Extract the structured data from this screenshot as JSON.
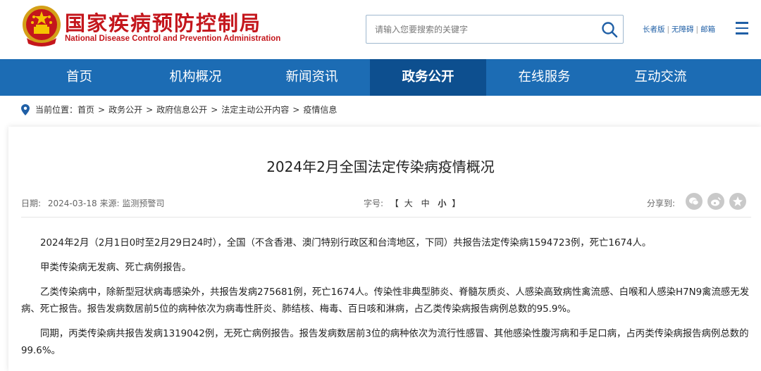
{
  "header": {
    "logo_cn": "国家疾病预防控制局",
    "logo_en": "National Disease Control and Prevention Administration",
    "search_placeholder": "请输入您要搜索的关键字",
    "links": [
      "长者版",
      "无障碍",
      "邮箱"
    ]
  },
  "nav": {
    "items": [
      "首页",
      "机构概况",
      "新闻资讯",
      "政务公开",
      "在线服务",
      "互动交流"
    ],
    "active_index": 3
  },
  "breadcrumb": {
    "label": "当前位置：",
    "items": [
      "首页",
      "政务公开",
      "政府信息公开",
      "法定主动公开内容",
      "疫情信息"
    ],
    "separator": ">"
  },
  "article": {
    "title": "2024年2月全国法定传染病疫情概况",
    "meta": {
      "date_label": "日期:",
      "date": "2024-03-18",
      "source_label": "来源:",
      "source": "监测预警司",
      "font_label": "字号:",
      "bracket_open": "【",
      "bracket_close": "】",
      "font_sizes": [
        "大",
        "中",
        "小"
      ],
      "share_label": "分享到:"
    },
    "paragraphs": [
      "2024年2月（2月1日0时至2月29日24时），全国（不含香港、澳门特别行政区和台湾地区，下同）共报告法定传染病1594723例，死亡1674人。",
      "甲类传染病无发病、死亡病例报告。",
      "乙类传染病中，除新型冠状病毒感染外，共报告发病275681例，死亡1674人。传染性非典型肺炎、脊髓灰质炎、人感染高致病性禽流感、白喉和人感染H7N9禽流感无发病、死亡报告。报告发病数居前5位的病种依次为病毒性肝炎、肺结核、梅毒、百日咳和淋病，占乙类传染病报告病例总数的95.9%。",
      "同期，丙类传染病共报告发病1319042例，无死亡病例报告。报告发病数居前3位的病种依次为流行性感冒、其他感染性腹泻病和手足口病，占丙类传染病报告病例总数的99.6%。"
    ]
  },
  "colors": {
    "brand_red": "#c4161c",
    "nav_blue": "#1c6cb4",
    "nav_active": "#0d4f8f",
    "link_blue": "#1f5fa6"
  },
  "icons": {
    "emblem": "national-emblem-icon",
    "search": "search-icon",
    "menu": "hamburger-menu-icon",
    "location": "location-pin-icon",
    "share": [
      "wechat-icon",
      "weibo-icon",
      "qzone-icon"
    ]
  }
}
